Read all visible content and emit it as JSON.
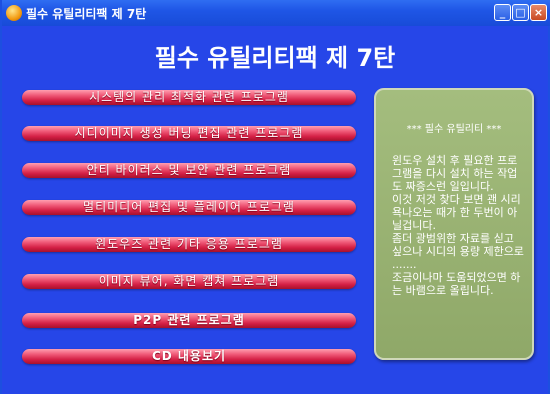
{
  "window": {
    "title": "필수 유틸리티팩 제 7탄",
    "minimize_glyph": "_",
    "maximize_glyph": "□",
    "close_glyph": "×"
  },
  "main": {
    "heading": "필수 유틸리티팩 제 7탄",
    "menu": [
      {
        "label": "시스템의 관리 최적화 관련 프로그램"
      },
      {
        "label": "시디이미지 생성 버닝 편집 관련 프로그램"
      },
      {
        "label": "안티 바이러스 및 보안 관련 프로그램"
      },
      {
        "label": "멀티미디어 편집 및 플레이어 프로그램"
      },
      {
        "label": "윈도우즈 관련 기타 응용 프로그램"
      },
      {
        "label": "이미지 뷰어, 화면 캡쳐 프로그램"
      },
      {
        "label": "P2P 관련 프로그램"
      },
      {
        "label": "CD 내용보기"
      }
    ]
  },
  "info_panel": {
    "title": "*** 필수 유틸리티 ***",
    "body": "윈도우 설치 후 필요한 프로그램을 다시 설치 하는 작업도 짜증스런 일입니다.\n이것 저것 찾다 보면 괜 시리 욕나오는 때가 한 두번이 아닐겁니다.\n좀더 광범위한 자료를 싣고 싶으나 시디의 용량 제한으로 .......\n조금이나마 도움되었으면 하는 바램으로 올립니다."
  },
  "colors": {
    "background": "#2646e8",
    "titlebar": "#1f56e6",
    "menu_button": "#d42045",
    "info_panel": "#9bb474"
  }
}
